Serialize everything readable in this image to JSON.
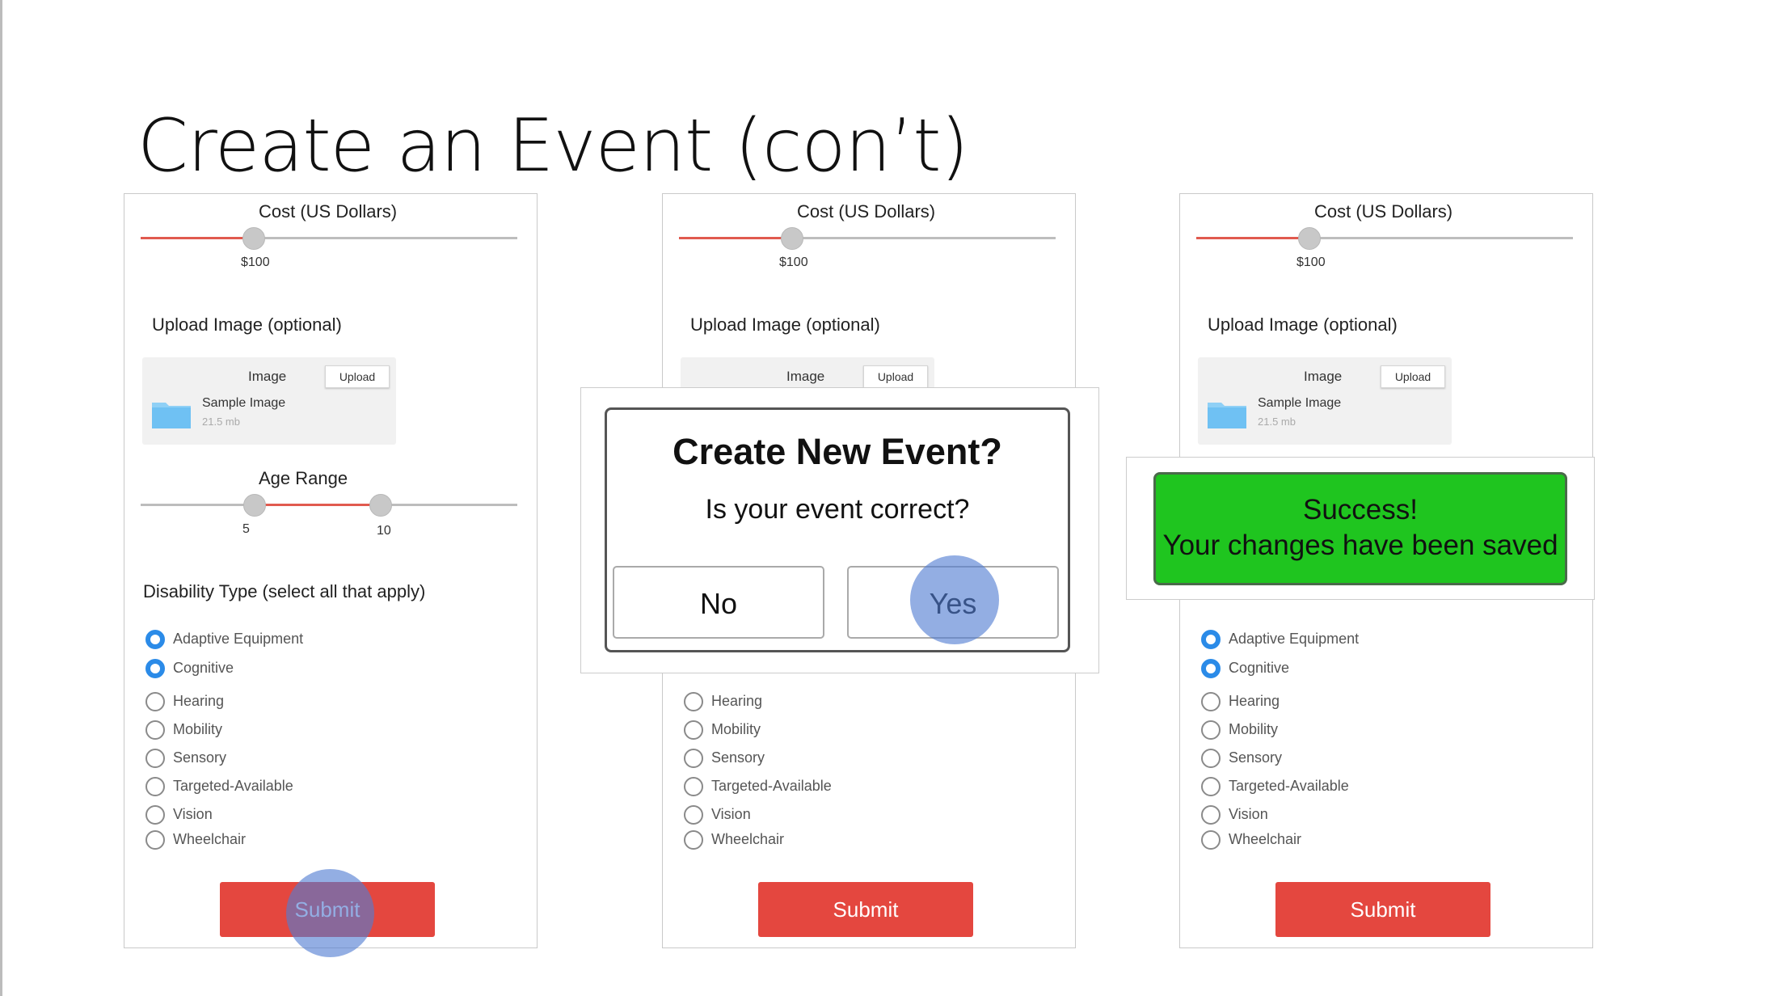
{
  "slide_title": "Create an Event (con’t)",
  "form": {
    "cost_label": "Cost (US Dollars)",
    "cost_value_label": "$100",
    "cost_value": 100,
    "upload_label": "Upload Image (optional)",
    "image_label": "Image",
    "upload_button": "Upload",
    "file_name": "Sample Image",
    "file_size": "21.5 mb",
    "age_label": "Age Range",
    "age_min_label": "5",
    "age_max_label": "10",
    "disability_label": "Disability Type (select all that apply)",
    "options": [
      {
        "label": "Adaptive Equipment",
        "checked": true
      },
      {
        "label": "Cognitive",
        "checked": true
      },
      {
        "label": "Hearing",
        "checked": false
      },
      {
        "label": "Mobility",
        "checked": false
      },
      {
        "label": "Sensory",
        "checked": false
      },
      {
        "label": "Targeted-Available",
        "checked": false
      },
      {
        "label": "Vision",
        "checked": false
      },
      {
        "label": "Wheelchair",
        "checked": false
      }
    ],
    "submit_label": "Submit"
  },
  "dialog": {
    "title": "Create New Event?",
    "message": "Is your event correct?",
    "no_label": "No",
    "yes_label": "Yes"
  },
  "toast": {
    "line1": "Success!",
    "line2": "Your changes have been saved",
    "color": "#1fc51f"
  },
  "colors": {
    "accent_blue": "#2b8be8",
    "submit_red": "#e4473f",
    "slider_red": "#e15a4f",
    "tap_indicator": "#507cd2"
  }
}
